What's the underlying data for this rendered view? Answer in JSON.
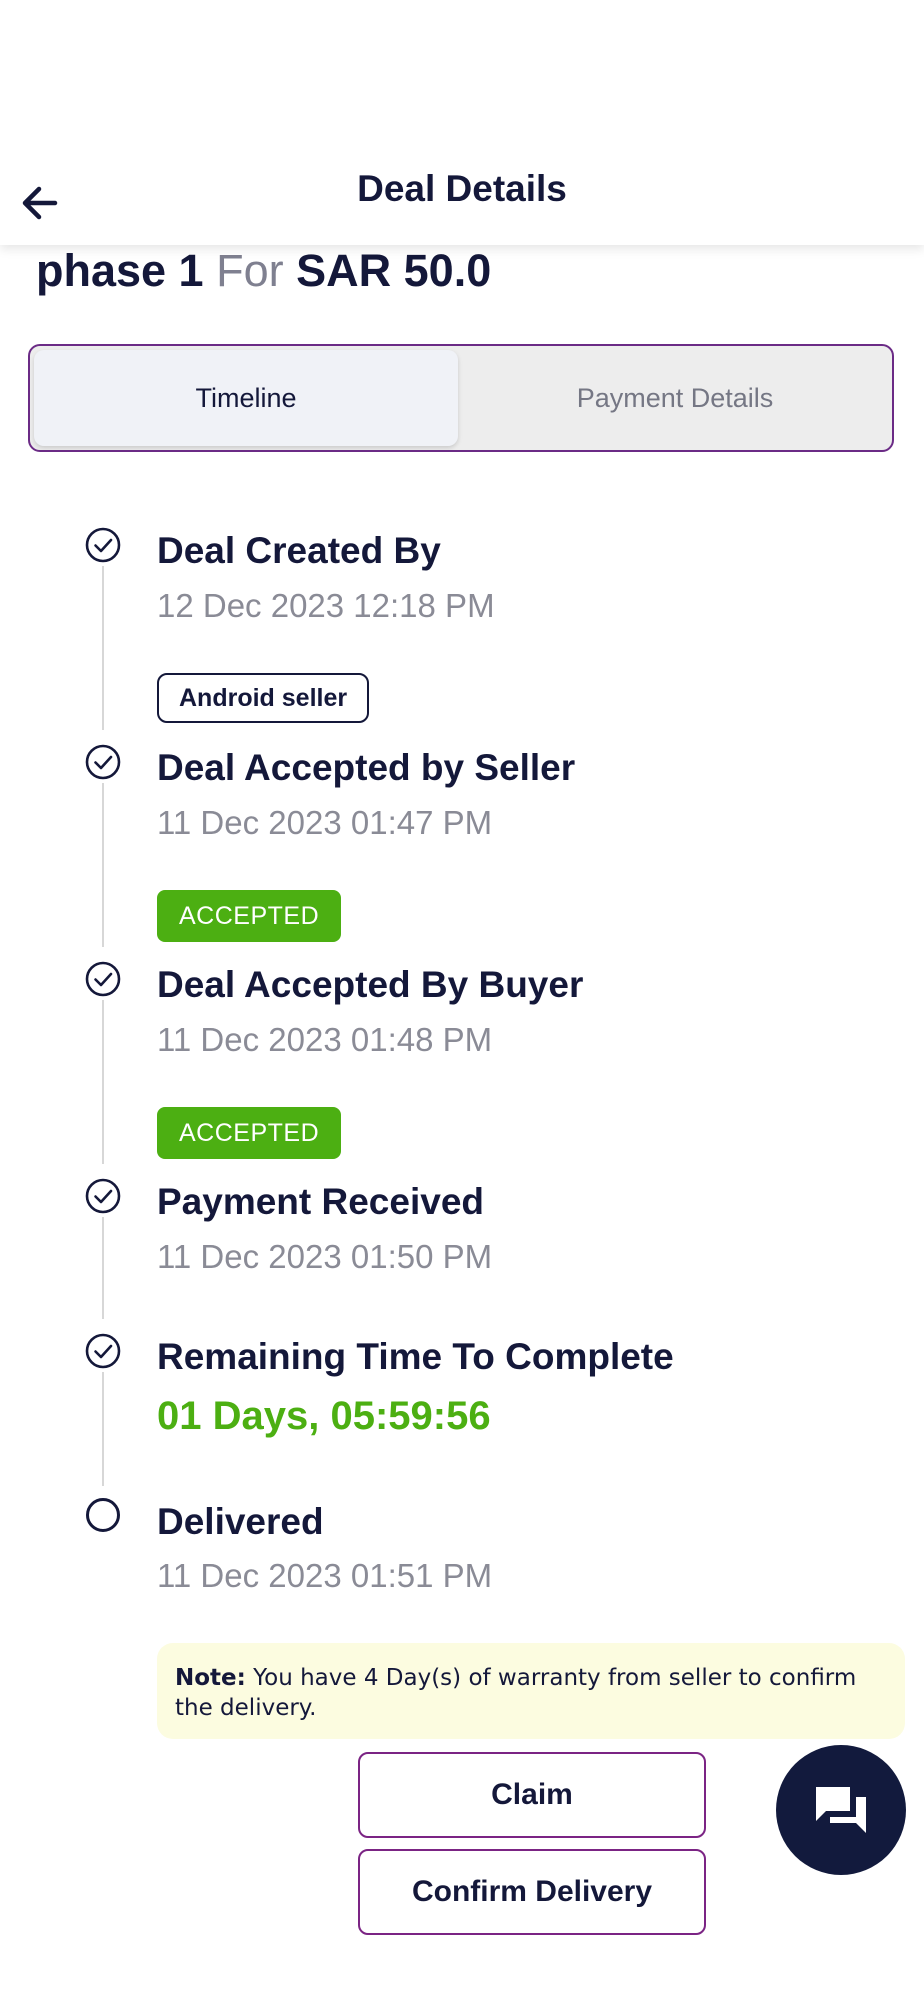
{
  "header": {
    "title": "Deal Details",
    "back_icon": "arrow-left-icon"
  },
  "deal": {
    "phase": "phase 1",
    "for_label": "For",
    "amount": "SAR 50.0"
  },
  "tabs": [
    {
      "label": "Timeline",
      "active": true
    },
    {
      "label": "Payment Details",
      "active": false
    }
  ],
  "timeline": [
    {
      "title": "Deal Created By",
      "time": "12 Dec 2023 12:18 PM",
      "badge": "Android seller",
      "completed": true
    },
    {
      "title": "Deal Accepted by Seller",
      "time": "11 Dec 2023 01:47 PM",
      "badge": "ACCEPTED",
      "completed": true
    },
    {
      "title": "Deal Accepted By Buyer",
      "time": "11 Dec 2023 01:48 PM",
      "badge": "ACCEPTED",
      "completed": true
    },
    {
      "title": "Payment Received",
      "time": "11 Dec 2023 01:50 PM",
      "completed": true
    },
    {
      "title": "Remaining Time To Complete",
      "countdown": "01 Days, 05:59:56",
      "completed": true
    },
    {
      "title": "Delivered",
      "time": "11 Dec 2023 01:51 PM",
      "completed": false
    }
  ],
  "note": {
    "label": "Note:",
    "text": " You have 4 Day(s) of warranty from seller to confirm the delivery."
  },
  "actions": {
    "claim": "Claim",
    "confirm_delivery": "Confirm Delivery"
  },
  "colors": {
    "primary_text": "#14183a",
    "accent_purple": "#7b2484",
    "success_green": "#4caf12",
    "note_background": "#fcfce0",
    "fab_background": "#121a3d"
  },
  "icons": {
    "step_done": "check-circle-icon",
    "step_pending": "empty-circle-icon",
    "chat": "chat-bubbles-icon"
  }
}
